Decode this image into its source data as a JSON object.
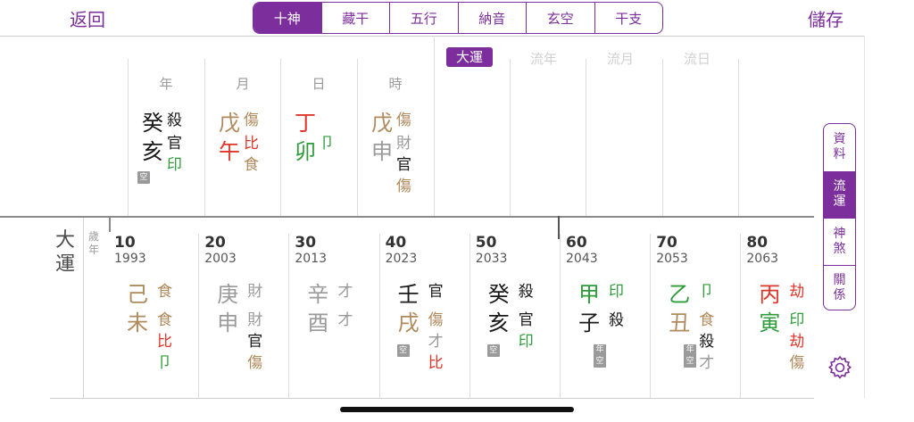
{
  "colors": {
    "accent": "#7b2e9c",
    "black": "#1a1a1a",
    "red": "#e0352b",
    "green": "#2e9c3a",
    "tan": "#b08a5c",
    "gray": "#9a9a9a",
    "lightgray": "#cccccc"
  },
  "nav": {
    "back": "返回",
    "save": "儲存"
  },
  "tabs": [
    "十神",
    "藏干",
    "五行",
    "納音",
    "玄空",
    "干支"
  ],
  "pillar_headers": [
    "年",
    "月",
    "日",
    "時"
  ],
  "pillars": [
    {
      "stem": "癸",
      "stem_c": "black",
      "branch": "亥",
      "branch_c": "black",
      "stem_god": "殺",
      "stem_god_c": "black",
      "hidden": [
        {
          "t": "官",
          "c": "black"
        },
        {
          "t": "印",
          "c": "green"
        }
      ],
      "kong": "空"
    },
    {
      "stem": "戊",
      "stem_c": "tan",
      "branch": "午",
      "branch_c": "red",
      "stem_god": "傷",
      "stem_god_c": "tan",
      "hidden": [
        {
          "t": "比",
          "c": "red"
        },
        {
          "t": "食",
          "c": "tan"
        }
      ]
    },
    {
      "stem": "丁",
      "stem_c": "red",
      "branch": "卯",
      "branch_c": "green",
      "stem_god": "",
      "stem_god_c": "black",
      "hidden": [
        {
          "t": "卩",
          "c": "green"
        }
      ]
    },
    {
      "stem": "戊",
      "stem_c": "tan",
      "branch": "申",
      "branch_c": "gray",
      "stem_god": "傷",
      "stem_god_c": "tan",
      "hidden": [
        {
          "t": "財",
          "c": "gray"
        },
        {
          "t": "官",
          "c": "black"
        },
        {
          "t": "傷",
          "c": "tan"
        }
      ]
    }
  ],
  "luck_headers": {
    "dayun": "大運",
    "liunian": "流年",
    "liuyue": "流月",
    "liuri": "流日"
  },
  "labels": {
    "dayun": "大運",
    "suinian": "歲年"
  },
  "dayun": [
    {
      "age": "10",
      "year": "1993",
      "stem": "己",
      "stem_c": "tan",
      "branch": "未",
      "branch_c": "tan",
      "stem_god": "食",
      "stem_god_c": "tan",
      "hidden": [
        {
          "t": "食",
          "c": "tan"
        },
        {
          "t": "比",
          "c": "red"
        },
        {
          "t": "卩",
          "c": "green"
        }
      ]
    },
    {
      "age": "20",
      "year": "2003",
      "stem": "庚",
      "stem_c": "gray",
      "branch": "申",
      "branch_c": "gray",
      "stem_god": "財",
      "stem_god_c": "gray",
      "hidden": [
        {
          "t": "財",
          "c": "gray"
        },
        {
          "t": "官",
          "c": "black"
        },
        {
          "t": "傷",
          "c": "tan"
        }
      ]
    },
    {
      "age": "30",
      "year": "2013",
      "stem": "辛",
      "stem_c": "gray",
      "branch": "酉",
      "branch_c": "gray",
      "stem_god": "才",
      "stem_god_c": "gray",
      "hidden": [
        {
          "t": "才",
          "c": "gray"
        }
      ]
    },
    {
      "age": "40",
      "year": "2023",
      "stem": "壬",
      "stem_c": "black",
      "branch": "戌",
      "branch_c": "tan",
      "stem_god": "官",
      "stem_god_c": "black",
      "hidden": [
        {
          "t": "傷",
          "c": "tan"
        },
        {
          "t": "才",
          "c": "gray"
        },
        {
          "t": "比",
          "c": "red"
        }
      ],
      "kong": "空"
    },
    {
      "age": "50",
      "year": "2033",
      "stem": "癸",
      "stem_c": "black",
      "branch": "亥",
      "branch_c": "black",
      "stem_god": "殺",
      "stem_god_c": "black",
      "hidden": [
        {
          "t": "官",
          "c": "black"
        },
        {
          "t": "印",
          "c": "green"
        }
      ],
      "kong": "空"
    },
    {
      "age": "60",
      "year": "2043",
      "stem": "甲",
      "stem_c": "green",
      "branch": "子",
      "branch_c": "black",
      "stem_god": "印",
      "stem_god_c": "green",
      "hidden": [
        {
          "t": "殺",
          "c": "black"
        }
      ],
      "kong2": [
        "年",
        "空"
      ]
    },
    {
      "age": "70",
      "year": "2053",
      "stem": "乙",
      "stem_c": "green",
      "branch": "丑",
      "branch_c": "tan",
      "stem_god": "卩",
      "stem_god_c": "green",
      "hidden": [
        {
          "t": "食",
          "c": "tan"
        },
        {
          "t": "殺",
          "c": "black"
        },
        {
          "t": "才",
          "c": "gray"
        }
      ],
      "kong2": [
        "年",
        "空"
      ]
    },
    {
      "age": "80",
      "year": "2063",
      "stem": "丙",
      "stem_c": "red",
      "branch": "寅",
      "branch_c": "green",
      "stem_god": "劫",
      "stem_god_c": "red",
      "hidden": [
        {
          "t": "印",
          "c": "green"
        },
        {
          "t": "劫",
          "c": "red"
        },
        {
          "t": "傷",
          "c": "tan"
        }
      ]
    }
  ],
  "side_tabs": [
    "資料",
    "流運",
    "神煞",
    "關係"
  ],
  "icons": {
    "settings": "gear-icon"
  }
}
